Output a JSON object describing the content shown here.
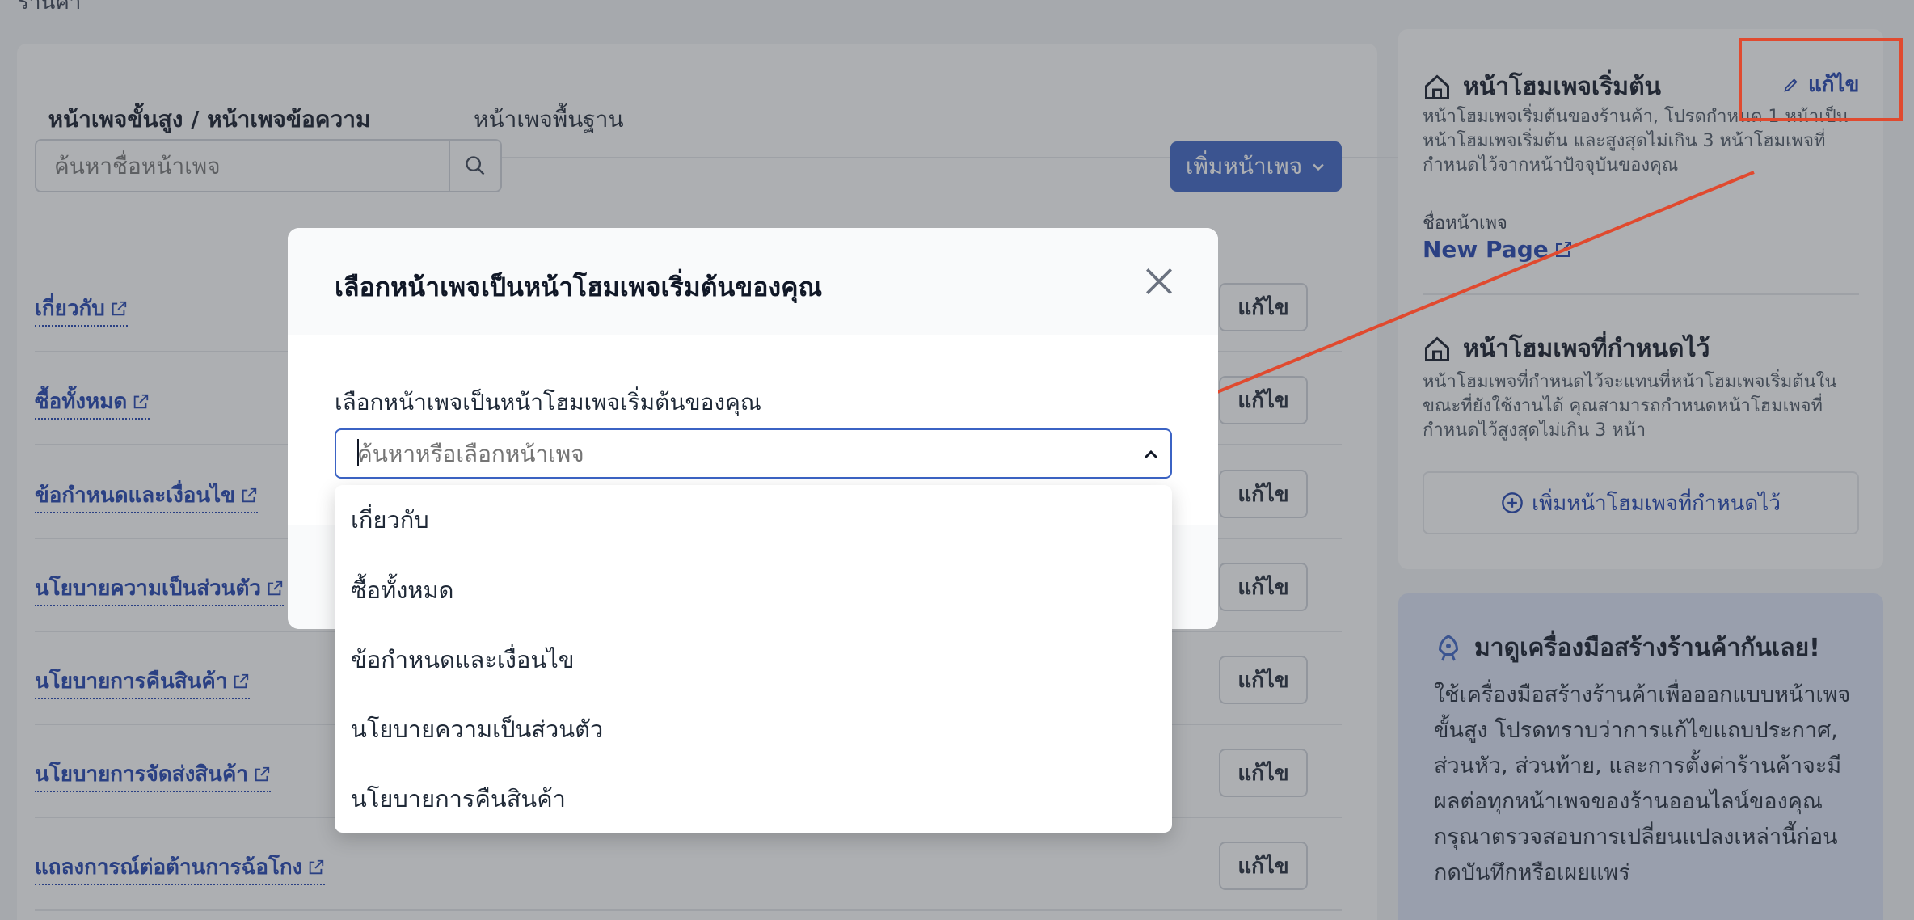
{
  "top_label": "ร้านค้า",
  "tabs": [
    {
      "label": "หน้าเพจขั้นสูง / หน้าเพจข้อความ"
    },
    {
      "label": "หน้าเพจพื้นฐาน"
    }
  ],
  "search": {
    "placeholder": "ค้นหาชื่อหน้าเพจ"
  },
  "add_page_button": "เพิ่มหน้าเพจ",
  "rows": [
    {
      "label": "เกี่ยวกับ",
      "edit": "แก้ไข"
    },
    {
      "label": "ซื้อทั้งหมด",
      "edit": "แก้ไข"
    },
    {
      "label": "ข้อกำหนดและเงื่อนไข",
      "edit": "แก้ไข"
    },
    {
      "label": "นโยบายความเป็นส่วนตัว",
      "edit": "แก้ไข"
    },
    {
      "label": "นโยบายการคืนสินค้า",
      "edit": "แก้ไข"
    },
    {
      "label": "นโยบายการจัดส่งสินค้า",
      "edit": "แก้ไข"
    },
    {
      "label": "แถลงการณ์ต่อต้านการฉ้อโกง",
      "edit": "แก้ไข"
    }
  ],
  "sidebar": {
    "default_home": {
      "title": "หน้าโฮมเพจเริ่มต้น",
      "edit": "แก้ไข",
      "desc_lines": [
        "หน้าโฮมเพจเริ่มต้นของร้านค้า, โปรดกำหนด 1 หน้าเป็น",
        "หน้าโฮมเพจเริ่มต้น และสูงสุดไม่เกิน 3 หน้าโฮมเพจที่",
        "กำหนดไว้จากหน้าปัจจุบันของคุณ"
      ],
      "page_name_label": "ชื่อหน้าเพจ",
      "page_name": "New Page"
    },
    "custom_home": {
      "title": "หน้าโฮมเพจที่กำหนดไว้",
      "desc_lines": [
        "หน้าโฮมเพจที่กำหนดไว้จะแทนที่หน้าโฮมเพจเริ่มต้นใน",
        "ขณะที่ยังใช้งานได้ คุณสามารถกำหนดหน้าโฮมเพจที่",
        "กำหนดไว้สูงสุดไม่เกิน 3 หน้า"
      ],
      "add_button": "เพิ่มหน้าโฮมเพจที่กำหนดไว้"
    },
    "promo": {
      "title": "มาดูเครื่องมือสร้างร้านค้ากันเลย!",
      "text": "ใช้เครื่องมือสร้างร้านค้าเพื่อออกแบบหน้าเพจขั้นสูง โปรดทราบว่าการแก้ไขแถบประกาศ, ส่วนหัว, ส่วนท้าย, และการตั้งค่าร้านค้าจะมีผลต่อทุกหน้าเพจของร้านออนไลน์ของคุณ กรุณาตรวจสอบการเปลี่ยนแปลงเหล่านี้ก่อนกดบันทึกหรือเผยแพร่"
    }
  },
  "modal": {
    "title": "เลือกหน้าเพจเป็นหน้าโฮมเพจเริ่มต้นของคุณ",
    "field_label": "เลือกหน้าเพจเป็นหน้าโฮมเพจเริ่มต้นของคุณ",
    "select_placeholder": "ค้นหาหรือเลือกหน้าเพจ",
    "options": [
      "เกี่ยวกับ",
      "ซื้อทั้งหมด",
      "ข้อกำหนดและเงื่อนไข",
      "นโยบายความเป็นส่วนตัว",
      "นโยบายการคืนสินค้า"
    ]
  },
  "colors": {
    "primary": "#3b63c4",
    "link": "#1e40af",
    "annotation": "#e04a2f"
  }
}
